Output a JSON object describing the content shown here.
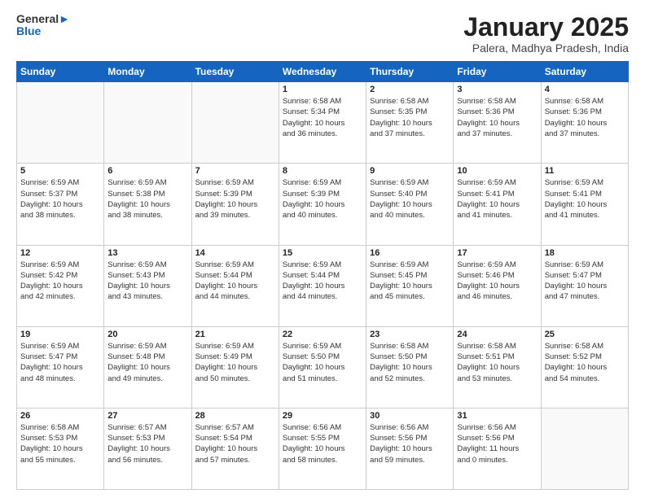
{
  "logo": {
    "text_general": "General",
    "text_blue": "Blue"
  },
  "header": {
    "month_title": "January 2025",
    "location": "Palera, Madhya Pradesh, India"
  },
  "days_of_week": [
    "Sunday",
    "Monday",
    "Tuesday",
    "Wednesday",
    "Thursday",
    "Friday",
    "Saturday"
  ],
  "weeks": [
    [
      {
        "day": "",
        "info": ""
      },
      {
        "day": "",
        "info": ""
      },
      {
        "day": "",
        "info": ""
      },
      {
        "day": "1",
        "info": "Sunrise: 6:58 AM\nSunset: 5:34 PM\nDaylight: 10 hours\nand 36 minutes."
      },
      {
        "day": "2",
        "info": "Sunrise: 6:58 AM\nSunset: 5:35 PM\nDaylight: 10 hours\nand 37 minutes."
      },
      {
        "day": "3",
        "info": "Sunrise: 6:58 AM\nSunset: 5:36 PM\nDaylight: 10 hours\nand 37 minutes."
      },
      {
        "day": "4",
        "info": "Sunrise: 6:58 AM\nSunset: 5:36 PM\nDaylight: 10 hours\nand 37 minutes."
      }
    ],
    [
      {
        "day": "5",
        "info": "Sunrise: 6:59 AM\nSunset: 5:37 PM\nDaylight: 10 hours\nand 38 minutes."
      },
      {
        "day": "6",
        "info": "Sunrise: 6:59 AM\nSunset: 5:38 PM\nDaylight: 10 hours\nand 38 minutes."
      },
      {
        "day": "7",
        "info": "Sunrise: 6:59 AM\nSunset: 5:39 PM\nDaylight: 10 hours\nand 39 minutes."
      },
      {
        "day": "8",
        "info": "Sunrise: 6:59 AM\nSunset: 5:39 PM\nDaylight: 10 hours\nand 40 minutes."
      },
      {
        "day": "9",
        "info": "Sunrise: 6:59 AM\nSunset: 5:40 PM\nDaylight: 10 hours\nand 40 minutes."
      },
      {
        "day": "10",
        "info": "Sunrise: 6:59 AM\nSunset: 5:41 PM\nDaylight: 10 hours\nand 41 minutes."
      },
      {
        "day": "11",
        "info": "Sunrise: 6:59 AM\nSunset: 5:41 PM\nDaylight: 10 hours\nand 41 minutes."
      }
    ],
    [
      {
        "day": "12",
        "info": "Sunrise: 6:59 AM\nSunset: 5:42 PM\nDaylight: 10 hours\nand 42 minutes."
      },
      {
        "day": "13",
        "info": "Sunrise: 6:59 AM\nSunset: 5:43 PM\nDaylight: 10 hours\nand 43 minutes."
      },
      {
        "day": "14",
        "info": "Sunrise: 6:59 AM\nSunset: 5:44 PM\nDaylight: 10 hours\nand 44 minutes."
      },
      {
        "day": "15",
        "info": "Sunrise: 6:59 AM\nSunset: 5:44 PM\nDaylight: 10 hours\nand 44 minutes."
      },
      {
        "day": "16",
        "info": "Sunrise: 6:59 AM\nSunset: 5:45 PM\nDaylight: 10 hours\nand 45 minutes."
      },
      {
        "day": "17",
        "info": "Sunrise: 6:59 AM\nSunset: 5:46 PM\nDaylight: 10 hours\nand 46 minutes."
      },
      {
        "day": "18",
        "info": "Sunrise: 6:59 AM\nSunset: 5:47 PM\nDaylight: 10 hours\nand 47 minutes."
      }
    ],
    [
      {
        "day": "19",
        "info": "Sunrise: 6:59 AM\nSunset: 5:47 PM\nDaylight: 10 hours\nand 48 minutes."
      },
      {
        "day": "20",
        "info": "Sunrise: 6:59 AM\nSunset: 5:48 PM\nDaylight: 10 hours\nand 49 minutes."
      },
      {
        "day": "21",
        "info": "Sunrise: 6:59 AM\nSunset: 5:49 PM\nDaylight: 10 hours\nand 50 minutes."
      },
      {
        "day": "22",
        "info": "Sunrise: 6:59 AM\nSunset: 5:50 PM\nDaylight: 10 hours\nand 51 minutes."
      },
      {
        "day": "23",
        "info": "Sunrise: 6:58 AM\nSunset: 5:50 PM\nDaylight: 10 hours\nand 52 minutes."
      },
      {
        "day": "24",
        "info": "Sunrise: 6:58 AM\nSunset: 5:51 PM\nDaylight: 10 hours\nand 53 minutes."
      },
      {
        "day": "25",
        "info": "Sunrise: 6:58 AM\nSunset: 5:52 PM\nDaylight: 10 hours\nand 54 minutes."
      }
    ],
    [
      {
        "day": "26",
        "info": "Sunrise: 6:58 AM\nSunset: 5:53 PM\nDaylight: 10 hours\nand 55 minutes."
      },
      {
        "day": "27",
        "info": "Sunrise: 6:57 AM\nSunset: 5:53 PM\nDaylight: 10 hours\nand 56 minutes."
      },
      {
        "day": "28",
        "info": "Sunrise: 6:57 AM\nSunset: 5:54 PM\nDaylight: 10 hours\nand 57 minutes."
      },
      {
        "day": "29",
        "info": "Sunrise: 6:56 AM\nSunset: 5:55 PM\nDaylight: 10 hours\nand 58 minutes."
      },
      {
        "day": "30",
        "info": "Sunrise: 6:56 AM\nSunset: 5:56 PM\nDaylight: 10 hours\nand 59 minutes."
      },
      {
        "day": "31",
        "info": "Sunrise: 6:56 AM\nSunset: 5:56 PM\nDaylight: 11 hours\nand 0 minutes."
      },
      {
        "day": "",
        "info": ""
      }
    ]
  ]
}
